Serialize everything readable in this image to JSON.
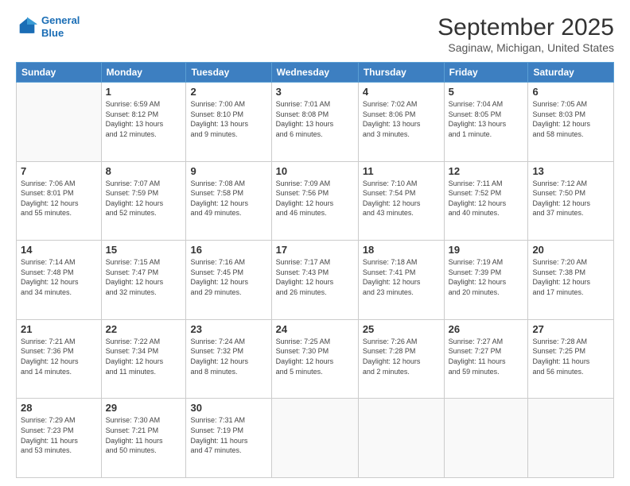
{
  "logo": {
    "line1": "General",
    "line2": "Blue"
  },
  "title": "September 2025",
  "subtitle": "Saginaw, Michigan, United States",
  "days_of_week": [
    "Sunday",
    "Monday",
    "Tuesday",
    "Wednesday",
    "Thursday",
    "Friday",
    "Saturday"
  ],
  "weeks": [
    [
      {
        "day": "",
        "info": ""
      },
      {
        "day": "1",
        "info": "Sunrise: 6:59 AM\nSunset: 8:12 PM\nDaylight: 13 hours\nand 12 minutes."
      },
      {
        "day": "2",
        "info": "Sunrise: 7:00 AM\nSunset: 8:10 PM\nDaylight: 13 hours\nand 9 minutes."
      },
      {
        "day": "3",
        "info": "Sunrise: 7:01 AM\nSunset: 8:08 PM\nDaylight: 13 hours\nand 6 minutes."
      },
      {
        "day": "4",
        "info": "Sunrise: 7:02 AM\nSunset: 8:06 PM\nDaylight: 13 hours\nand 3 minutes."
      },
      {
        "day": "5",
        "info": "Sunrise: 7:04 AM\nSunset: 8:05 PM\nDaylight: 13 hours\nand 1 minute."
      },
      {
        "day": "6",
        "info": "Sunrise: 7:05 AM\nSunset: 8:03 PM\nDaylight: 12 hours\nand 58 minutes."
      }
    ],
    [
      {
        "day": "7",
        "info": "Sunrise: 7:06 AM\nSunset: 8:01 PM\nDaylight: 12 hours\nand 55 minutes."
      },
      {
        "day": "8",
        "info": "Sunrise: 7:07 AM\nSunset: 7:59 PM\nDaylight: 12 hours\nand 52 minutes."
      },
      {
        "day": "9",
        "info": "Sunrise: 7:08 AM\nSunset: 7:58 PM\nDaylight: 12 hours\nand 49 minutes."
      },
      {
        "day": "10",
        "info": "Sunrise: 7:09 AM\nSunset: 7:56 PM\nDaylight: 12 hours\nand 46 minutes."
      },
      {
        "day": "11",
        "info": "Sunrise: 7:10 AM\nSunset: 7:54 PM\nDaylight: 12 hours\nand 43 minutes."
      },
      {
        "day": "12",
        "info": "Sunrise: 7:11 AM\nSunset: 7:52 PM\nDaylight: 12 hours\nand 40 minutes."
      },
      {
        "day": "13",
        "info": "Sunrise: 7:12 AM\nSunset: 7:50 PM\nDaylight: 12 hours\nand 37 minutes."
      }
    ],
    [
      {
        "day": "14",
        "info": "Sunrise: 7:14 AM\nSunset: 7:48 PM\nDaylight: 12 hours\nand 34 minutes."
      },
      {
        "day": "15",
        "info": "Sunrise: 7:15 AM\nSunset: 7:47 PM\nDaylight: 12 hours\nand 32 minutes."
      },
      {
        "day": "16",
        "info": "Sunrise: 7:16 AM\nSunset: 7:45 PM\nDaylight: 12 hours\nand 29 minutes."
      },
      {
        "day": "17",
        "info": "Sunrise: 7:17 AM\nSunset: 7:43 PM\nDaylight: 12 hours\nand 26 minutes."
      },
      {
        "day": "18",
        "info": "Sunrise: 7:18 AM\nSunset: 7:41 PM\nDaylight: 12 hours\nand 23 minutes."
      },
      {
        "day": "19",
        "info": "Sunrise: 7:19 AM\nSunset: 7:39 PM\nDaylight: 12 hours\nand 20 minutes."
      },
      {
        "day": "20",
        "info": "Sunrise: 7:20 AM\nSunset: 7:38 PM\nDaylight: 12 hours\nand 17 minutes."
      }
    ],
    [
      {
        "day": "21",
        "info": "Sunrise: 7:21 AM\nSunset: 7:36 PM\nDaylight: 12 hours\nand 14 minutes."
      },
      {
        "day": "22",
        "info": "Sunrise: 7:22 AM\nSunset: 7:34 PM\nDaylight: 12 hours\nand 11 minutes."
      },
      {
        "day": "23",
        "info": "Sunrise: 7:24 AM\nSunset: 7:32 PM\nDaylight: 12 hours\nand 8 minutes."
      },
      {
        "day": "24",
        "info": "Sunrise: 7:25 AM\nSunset: 7:30 PM\nDaylight: 12 hours\nand 5 minutes."
      },
      {
        "day": "25",
        "info": "Sunrise: 7:26 AM\nSunset: 7:28 PM\nDaylight: 12 hours\nand 2 minutes."
      },
      {
        "day": "26",
        "info": "Sunrise: 7:27 AM\nSunset: 7:27 PM\nDaylight: 11 hours\nand 59 minutes."
      },
      {
        "day": "27",
        "info": "Sunrise: 7:28 AM\nSunset: 7:25 PM\nDaylight: 11 hours\nand 56 minutes."
      }
    ],
    [
      {
        "day": "28",
        "info": "Sunrise: 7:29 AM\nSunset: 7:23 PM\nDaylight: 11 hours\nand 53 minutes."
      },
      {
        "day": "29",
        "info": "Sunrise: 7:30 AM\nSunset: 7:21 PM\nDaylight: 11 hours\nand 50 minutes."
      },
      {
        "day": "30",
        "info": "Sunrise: 7:31 AM\nSunset: 7:19 PM\nDaylight: 11 hours\nand 47 minutes."
      },
      {
        "day": "",
        "info": ""
      },
      {
        "day": "",
        "info": ""
      },
      {
        "day": "",
        "info": ""
      },
      {
        "day": "",
        "info": ""
      }
    ]
  ]
}
